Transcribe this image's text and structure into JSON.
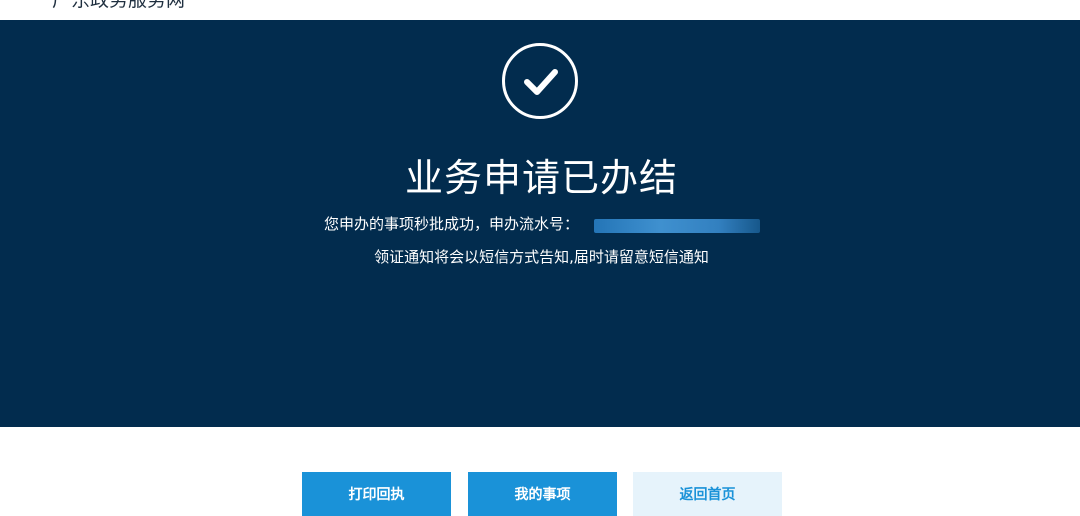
{
  "header": {
    "site_name": "广东政务服务网",
    "logo_icon": "logo-icon"
  },
  "result": {
    "status_icon": "check-circle-icon",
    "title": "业务申请已办结",
    "message_prefix": "您申办的事项秒批成功，申办流水号：",
    "notice": "领证通知将会以短信方式告知,届时请留意短信通知"
  },
  "actions": {
    "print_receipt": "打印回执",
    "my_items": "我的事项",
    "back_home": "返回首页"
  },
  "colors": {
    "hero_bg": "#022c4e",
    "primary": "#1a92d8",
    "secondary_bg": "#e6f3fb"
  }
}
